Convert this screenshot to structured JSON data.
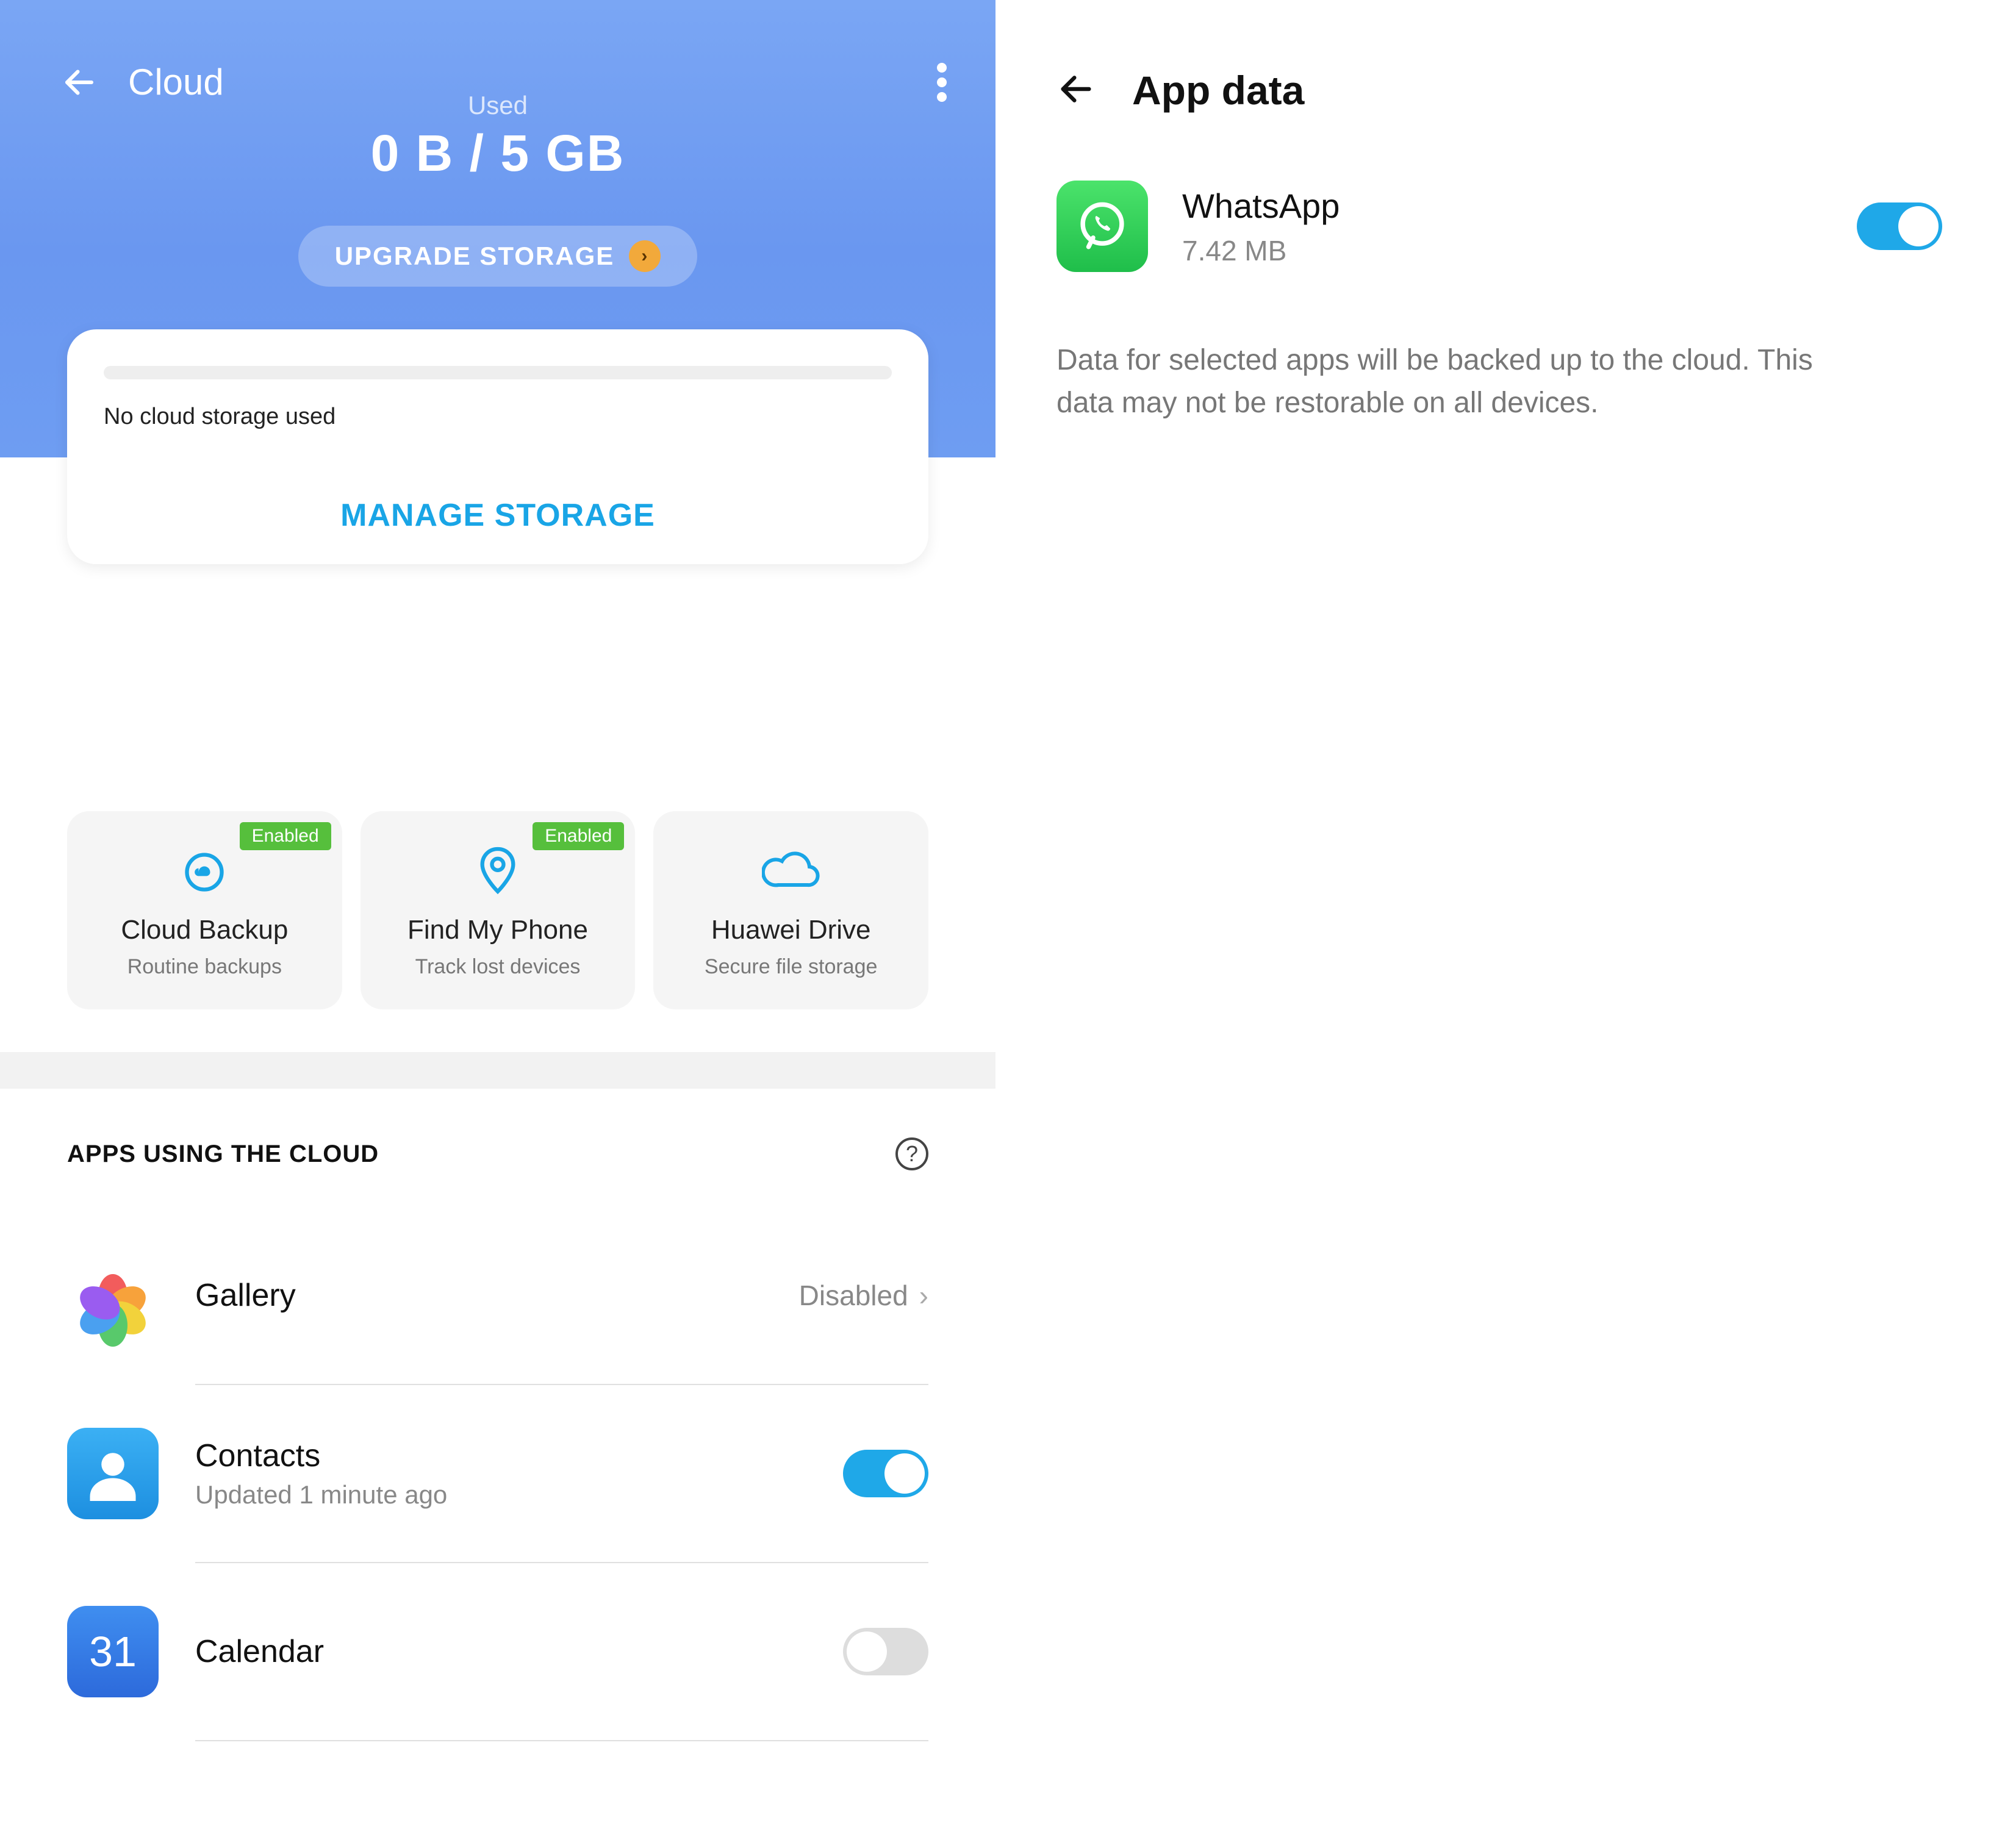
{
  "left": {
    "title": "Cloud",
    "used_label": "Used",
    "used_value": "0 B / 5 GB",
    "upgrade_label": "UPGRADE STORAGE",
    "storage_card": {
      "message": "No cloud storage used",
      "manage_label": "MANAGE STORAGE"
    },
    "features": [
      {
        "badge": "Enabled",
        "title": "Cloud Backup",
        "sub": "Routine backups"
      },
      {
        "badge": "Enabled",
        "title": "Find My Phone",
        "sub": "Track lost devices"
      },
      {
        "badge": "",
        "title": "Huawei Drive",
        "sub": "Secure file storage"
      }
    ],
    "apps_header": "APPS USING THE CLOUD",
    "apps": [
      {
        "name": "Gallery",
        "sub": "",
        "status": "Disabled",
        "toggle": null
      },
      {
        "name": "Contacts",
        "sub": "Updated 1 minute ago",
        "status": "",
        "toggle": true
      },
      {
        "name": "Calendar",
        "sub": "",
        "status": "",
        "toggle": false
      }
    ],
    "calendar_day": "31"
  },
  "right": {
    "title": "App data",
    "app": {
      "name": "WhatsApp",
      "size": "7.42 MB",
      "toggle": true
    },
    "description": "Data for selected apps will be backed up to the cloud. This data may not be restorable on all devices."
  }
}
